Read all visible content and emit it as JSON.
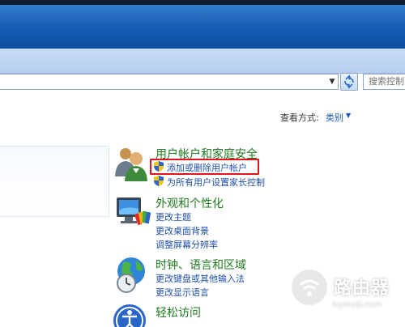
{
  "search": {
    "placeholder": "搜索控制"
  },
  "view": {
    "label": "查看方式:",
    "value": "类别"
  },
  "categories": [
    {
      "title": "用户帐户和家庭安全",
      "icon": "users-icon",
      "links": [
        "添加或删除用户帐户",
        "为所有用户设置家长控制"
      ]
    },
    {
      "title": "外观和个性化",
      "icon": "monitor-paint-icon",
      "links": [
        "更改主题",
        "更改桌面背景",
        "调整屏幕分辨率"
      ]
    },
    {
      "title": "时钟、语言和区域",
      "icon": "globe-clock-icon",
      "links": [
        "更改键盘或其他输入法",
        "更改显示语言"
      ]
    },
    {
      "title": "轻松访问",
      "icon": "ease-of-access-icon",
      "links": []
    }
  ],
  "watermark": {
    "text": "路由器",
    "sub": "luyouqi.com"
  },
  "colors": {
    "title_bar": "#1c64bb",
    "category_title": "#1e7a1e",
    "link": "#1e4fa8",
    "highlight": "#e0161c"
  }
}
